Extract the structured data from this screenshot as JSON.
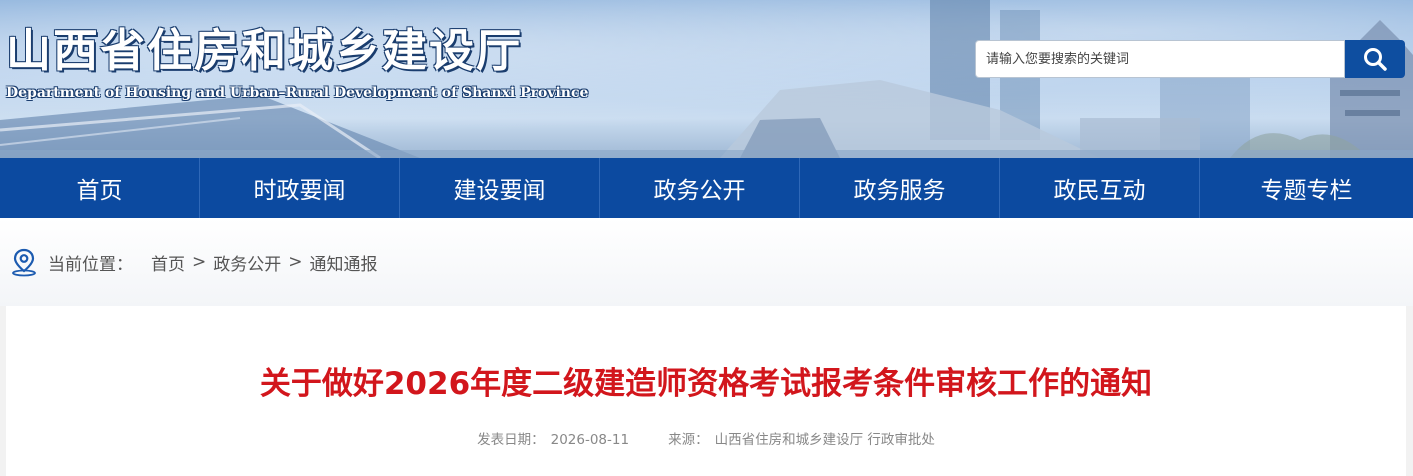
{
  "header": {
    "title": "山西省住房和城乡建设厅",
    "subtitle": "Department of Housing and Urban–Rural Development of Shanxi Province",
    "search_placeholder": "请输入您要搜索的关键词",
    "search_icon": "search-icon"
  },
  "nav": {
    "items": [
      {
        "label": "首页"
      },
      {
        "label": "时政要闻"
      },
      {
        "label": "建设要闻"
      },
      {
        "label": "政务公开"
      },
      {
        "label": "政务服务"
      },
      {
        "label": "政民互动"
      },
      {
        "label": "专题专栏"
      }
    ]
  },
  "breadcrumb": {
    "label": "当前位置：",
    "items": [
      "首页",
      "政务公开",
      "通知通报"
    ],
    "separator": ">"
  },
  "article": {
    "title": "关于做好2026年度二级建造师资格考试报考条件审核工作的通知",
    "date_label": "发表日期：",
    "date": "2026-08-11",
    "source_label": "来源：",
    "source": "山西省住房和城乡建设厅 行政审批处"
  },
  "colors": {
    "nav_bg": "#0c4aa0",
    "title_red": "#d2161c",
    "search_button": "#0e4ea0"
  }
}
